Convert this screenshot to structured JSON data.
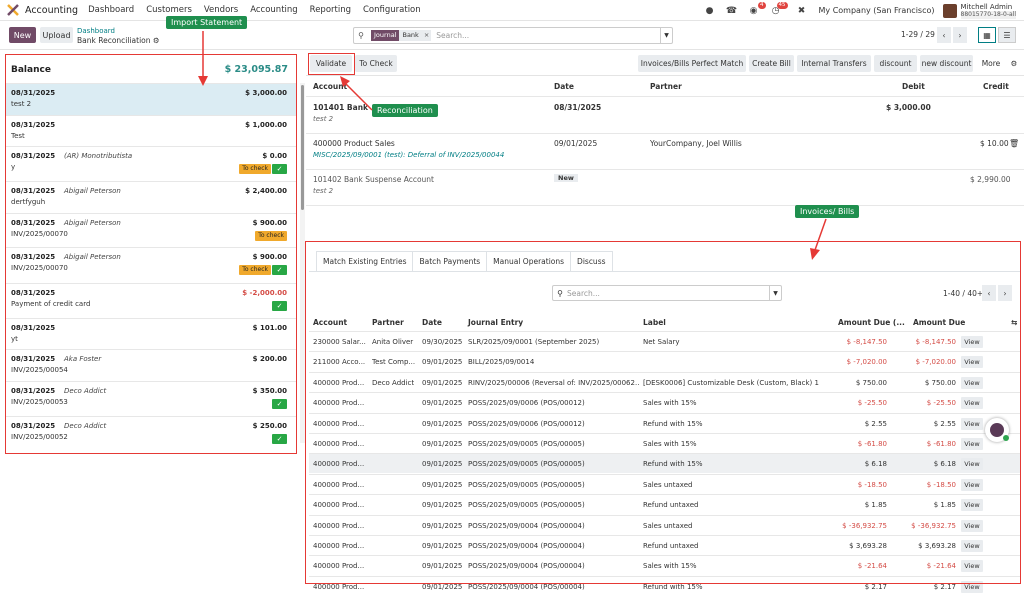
{
  "navbar": {
    "app_name": "Accounting",
    "menu": [
      "Dashboard",
      "Customers",
      "Vendors",
      "Accounting",
      "Reporting",
      "Configuration"
    ],
    "chat_badge": "4",
    "activity_badge": "45",
    "company": "My Company (San Francisco)",
    "user_name": "Mitchell Admin",
    "user_db": "88015770-18-0-all"
  },
  "controlpanel": {
    "new_label": "New",
    "upload_label": "Upload",
    "breadcrumb_parent": "Dashboard",
    "breadcrumb_current": "Bank Reconciliation",
    "search_facet_type": "Journal",
    "search_facet_value": "Bank",
    "search_placeholder": "Search...",
    "pager": "1-29 / 29"
  },
  "left": {
    "balance_label": "Balance",
    "balance_amount": "$ 23,095.87",
    "statements": [
      {
        "date": "08/31/2025",
        "partner": "",
        "amount": "$ 3,000.00",
        "label": "test 2",
        "status": "",
        "negative": false
      },
      {
        "date": "08/31/2025",
        "partner": "",
        "amount": "$ 1,000.00",
        "label": "Test",
        "status": "",
        "negative": false
      },
      {
        "date": "08/31/2025",
        "partner": "(AR) Monotributista",
        "amount": "$ 0.00",
        "label": "y",
        "status": "To check",
        "negative": false
      },
      {
        "date": "08/31/2025",
        "partner": "Abigail Peterson",
        "amount": "$ 2,400.00",
        "label": "dertfyguh",
        "status": "",
        "negative": false
      },
      {
        "date": "08/31/2025",
        "partner": "Abigail Peterson",
        "amount": "$ 900.00",
        "label": "INV/2025/00070",
        "status": "To check",
        "negative": false
      },
      {
        "date": "08/31/2025",
        "partner": "Abigail Peterson",
        "amount": "$ 900.00",
        "label": "INV/2025/00070",
        "status": "To check",
        "negative": false
      },
      {
        "date": "08/31/2025",
        "partner": "",
        "amount": "$ -2,000.00",
        "label": "Payment of credit card",
        "status": "",
        "negative": true
      },
      {
        "date": "08/31/2025",
        "partner": "",
        "amount": "$ 101.00",
        "label": "yt",
        "status": "",
        "negative": false
      },
      {
        "date": "08/31/2025",
        "partner": "Aka Foster",
        "amount": "$ 200.00",
        "label": "INV/2025/00054",
        "status": "",
        "negative": false
      },
      {
        "date": "08/31/2025",
        "partner": "Deco Addict",
        "amount": "$ 350.00",
        "label": "INV/2025/00053",
        "status": "",
        "negative": false
      },
      {
        "date": "08/31/2025",
        "partner": "Deco Addict",
        "amount": "$ 250.00",
        "label": "INV/2025/00052",
        "status": "",
        "negative": false
      }
    ]
  },
  "right": {
    "buttons": [
      "Validate",
      "To Check",
      "Invoices/Bills Perfect Match",
      "Create Bill",
      "Internal Transfers",
      "discount",
      "new discount",
      "More"
    ],
    "headers": {
      "account": "Account",
      "date": "Date",
      "partner": "Partner",
      "debit": "Debit",
      "credit": "Credit"
    },
    "line1": {
      "account": "101401 Bank",
      "sub": "test 2",
      "date": "08/31/2025",
      "debit": "$ 3,000.00"
    },
    "line2": {
      "account": "400000 Product Sales",
      "sub": "MISC/2025/09/0001 (test): Deferral of INV/2025/00044",
      "date": "09/01/2025",
      "partner": "YourCompany, Joel Willis",
      "credit": "$ 10.00"
    },
    "line3": {
      "account": "101402 Bank Suspense Account",
      "sub": "test 2",
      "badge": "New",
      "credit": "$ 2,990.00"
    },
    "tabs": [
      "Match Existing Entries",
      "Batch Payments",
      "Manual Operations",
      "Discuss"
    ],
    "search_placeholder": "Search...",
    "pager": "1-40 / 40+",
    "cols": [
      "Account",
      "Partner",
      "Date",
      "Journal Entry",
      "Label",
      "Amount Due (...",
      "Amount Due"
    ],
    "view_label": "View",
    "rows": [
      {
        "account": "230000 Salar...",
        "partner": "Anita Oliver",
        "date": "09/30/2025",
        "entry": "SLR/2025/09/0001 (September 2025)",
        "label": "Net Salary",
        "due1": "$ -8,147.50",
        "due2": "$ -8,147.50",
        "neg": true
      },
      {
        "account": "211000 Acco...",
        "partner": "Test Comp...",
        "date": "09/01/2025",
        "entry": "BILL/2025/09/0014",
        "label": "",
        "due1": "$ -7,020.00",
        "due2": "$ -7,020.00",
        "neg": true
      },
      {
        "account": "400000 Prod...",
        "partner": "Deco Addict",
        "date": "09/01/2025",
        "entry": "RINV/2025/00006 (Reversal of: INV/2025/00062...",
        "label": "[DESK0006] Customizable Desk (Custom, Black) 160x8...",
        "due1": "$ 750.00",
        "due2": "$ 750.00",
        "neg": false
      },
      {
        "account": "400000 Prod...",
        "partner": "",
        "date": "09/01/2025",
        "entry": "POSS/2025/09/0006 (POS/00012)",
        "label": "Sales with 15%",
        "due1": "$ -25.50",
        "due2": "$ -25.50",
        "neg": true
      },
      {
        "account": "400000 Prod...",
        "partner": "",
        "date": "09/01/2025",
        "entry": "POSS/2025/09/0006 (POS/00012)",
        "label": "Refund with 15%",
        "due1": "$ 2.55",
        "due2": "$ 2.55",
        "neg": false
      },
      {
        "account": "400000 Prod...",
        "partner": "",
        "date": "09/01/2025",
        "entry": "POSS/2025/09/0005 (POS/00005)",
        "label": "Sales with 15%",
        "due1": "$ -61.80",
        "due2": "$ -61.80",
        "neg": true
      },
      {
        "account": "400000 Prod...",
        "partner": "",
        "date": "09/01/2025",
        "entry": "POSS/2025/09/0005 (POS/00005)",
        "label": "Refund with 15%",
        "due1": "$ 6.18",
        "due2": "$ 6.18",
        "neg": false
      },
      {
        "account": "400000 Prod...",
        "partner": "",
        "date": "09/01/2025",
        "entry": "POSS/2025/09/0005 (POS/00005)",
        "label": "Sales untaxed",
        "due1": "$ -18.50",
        "due2": "$ -18.50",
        "neg": true
      },
      {
        "account": "400000 Prod...",
        "partner": "",
        "date": "09/01/2025",
        "entry": "POSS/2025/09/0005 (POS/00005)",
        "label": "Refund untaxed",
        "due1": "$ 1.85",
        "due2": "$ 1.85",
        "neg": false
      },
      {
        "account": "400000 Prod...",
        "partner": "",
        "date": "09/01/2025",
        "entry": "POSS/2025/09/0004 (POS/00004)",
        "label": "Sales untaxed",
        "due1": "$ -36,932.75",
        "due2": "$ -36,932.75",
        "neg": true
      },
      {
        "account": "400000 Prod...",
        "partner": "",
        "date": "09/01/2025",
        "entry": "POSS/2025/09/0004 (POS/00004)",
        "label": "Refund untaxed",
        "due1": "$ 3,693.28",
        "due2": "$ 3,693.28",
        "neg": false
      },
      {
        "account": "400000 Prod...",
        "partner": "",
        "date": "09/01/2025",
        "entry": "POSS/2025/09/0004 (POS/00004)",
        "label": "Sales with 15%",
        "due1": "$ -21.64",
        "due2": "$ -21.64",
        "neg": true
      },
      {
        "account": "400000 Prod...",
        "partner": "",
        "date": "09/01/2025",
        "entry": "POSS/2025/09/0004 (POS/00004)",
        "label": "Refund with 15%",
        "due1": "$ 2.17",
        "due2": "$ 2.17",
        "neg": false
      }
    ]
  },
  "annotations": {
    "import_statement": "Import Statement",
    "reconciliation": "Reconciliation",
    "invoices_bills": "Invoices/ Bills",
    "color": "#e53935",
    "tip_color": "#1f8f4e"
  },
  "colors": {
    "brand": "#714b67",
    "teal": "#017e84",
    "negative": "#d44c46",
    "ok": "#28a745",
    "warn": "#f0a92c"
  }
}
